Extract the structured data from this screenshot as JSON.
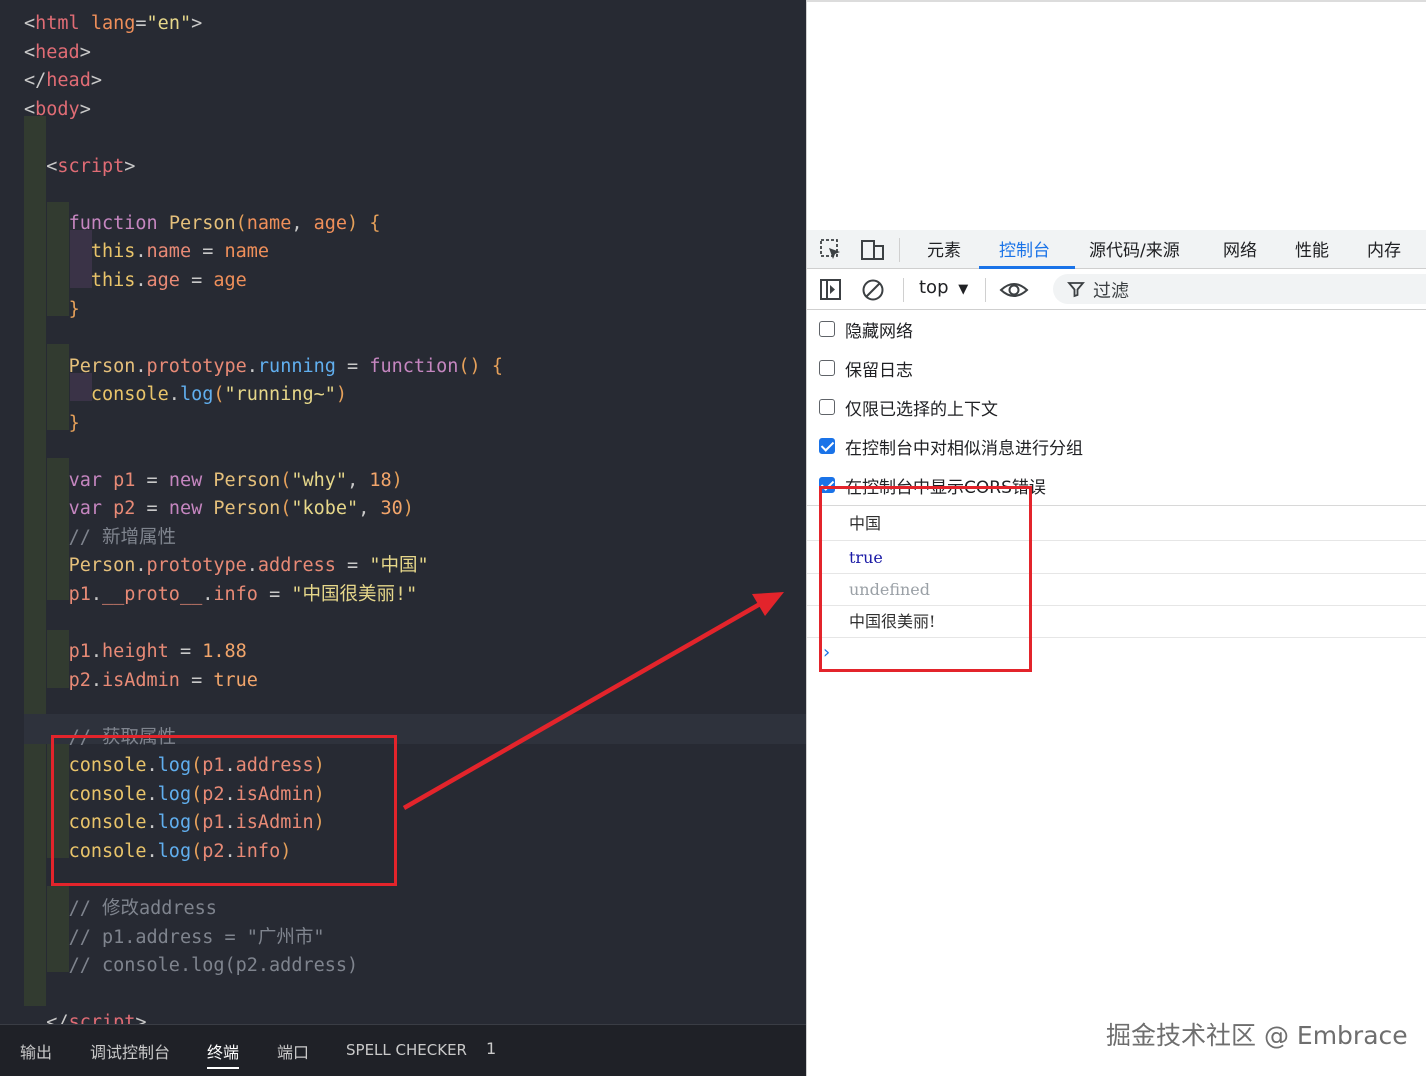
{
  "editor": {
    "lines": [
      [
        [
          "tag_lt",
          "<"
        ],
        [
          "tag",
          "html"
        ],
        [
          "plain",
          " "
        ],
        [
          "prm",
          "lang"
        ],
        [
          "op",
          "="
        ],
        [
          "str",
          "\"en\""
        ],
        [
          "tag_lt",
          ">"
        ]
      ],
      [
        [
          "tag_lt",
          "<"
        ],
        [
          "tag",
          "head"
        ],
        [
          "tag_lt",
          ">"
        ]
      ],
      [
        [
          "tag_lt",
          "</"
        ],
        [
          "tag",
          "head"
        ],
        [
          "tag_lt",
          ">"
        ]
      ],
      [
        [
          "tag_lt",
          "<"
        ],
        [
          "tag",
          "body"
        ],
        [
          "tag_lt",
          ">"
        ]
      ],
      [],
      [
        [
          "plain",
          "  "
        ],
        [
          "tag_lt",
          "<"
        ],
        [
          "tag",
          "script"
        ],
        [
          "tag_lt",
          ">"
        ]
      ],
      [],
      [
        [
          "plain",
          "    "
        ],
        [
          "kw",
          "function"
        ],
        [
          "plain",
          " "
        ],
        [
          "fn",
          "Person"
        ],
        [
          "brk",
          "("
        ],
        [
          "prm",
          "name"
        ],
        [
          "op",
          ", "
        ],
        [
          "prm",
          "age"
        ],
        [
          "brk",
          ")"
        ],
        [
          "plain",
          " "
        ],
        [
          "brk",
          "{"
        ]
      ],
      [
        [
          "plain",
          "      "
        ],
        [
          "obj",
          "this"
        ],
        [
          "op",
          "."
        ],
        [
          "prop",
          "name"
        ],
        [
          "op",
          " = "
        ],
        [
          "prm",
          "name"
        ]
      ],
      [
        [
          "plain",
          "      "
        ],
        [
          "obj",
          "this"
        ],
        [
          "op",
          "."
        ],
        [
          "prop",
          "age"
        ],
        [
          "op",
          " = "
        ],
        [
          "prm",
          "age"
        ]
      ],
      [
        [
          "plain",
          "    "
        ],
        [
          "brk",
          "}"
        ]
      ],
      [],
      [
        [
          "plain",
          "    "
        ],
        [
          "cls",
          "Person"
        ],
        [
          "op",
          "."
        ],
        [
          "prop",
          "prototype"
        ],
        [
          "op",
          "."
        ],
        [
          "meth",
          "running"
        ],
        [
          "op",
          " = "
        ],
        [
          "kw",
          "function"
        ],
        [
          "brk",
          "()"
        ],
        [
          "plain",
          " "
        ],
        [
          "brk",
          "{"
        ]
      ],
      [
        [
          "plain",
          "      "
        ],
        [
          "obj",
          "console"
        ],
        [
          "op",
          "."
        ],
        [
          "meth",
          "log"
        ],
        [
          "brk",
          "("
        ],
        [
          "str",
          "\"running~\""
        ],
        [
          "brk",
          ")"
        ]
      ],
      [
        [
          "plain",
          "    "
        ],
        [
          "brk",
          "}"
        ]
      ],
      [],
      [
        [
          "plain",
          "    "
        ],
        [
          "kw",
          "var"
        ],
        [
          "plain",
          " "
        ],
        [
          "prop",
          "p1"
        ],
        [
          "op",
          " = "
        ],
        [
          "kw",
          "new"
        ],
        [
          "plain",
          " "
        ],
        [
          "fn",
          "Person"
        ],
        [
          "brk",
          "("
        ],
        [
          "str",
          "\"why\""
        ],
        [
          "op",
          ", "
        ],
        [
          "num",
          "18"
        ],
        [
          "brk",
          ")"
        ]
      ],
      [
        [
          "plain",
          "    "
        ],
        [
          "kw",
          "var"
        ],
        [
          "plain",
          " "
        ],
        [
          "prop",
          "p2"
        ],
        [
          "op",
          " = "
        ],
        [
          "kw",
          "new"
        ],
        [
          "plain",
          " "
        ],
        [
          "fn",
          "Person"
        ],
        [
          "brk",
          "("
        ],
        [
          "str",
          "\"kobe\""
        ],
        [
          "op",
          ", "
        ],
        [
          "num",
          "30"
        ],
        [
          "brk",
          ")"
        ]
      ],
      [
        [
          "plain",
          "    "
        ],
        [
          "com",
          "// 新增属性"
        ]
      ],
      [
        [
          "plain",
          "    "
        ],
        [
          "cls",
          "Person"
        ],
        [
          "op",
          "."
        ],
        [
          "prop",
          "prototype"
        ],
        [
          "op",
          "."
        ],
        [
          "prop",
          "address"
        ],
        [
          "op",
          " = "
        ],
        [
          "str",
          "\"中国\""
        ]
      ],
      [
        [
          "plain",
          "    "
        ],
        [
          "prop",
          "p1"
        ],
        [
          "op",
          "."
        ],
        [
          "prop",
          "__proto__"
        ],
        [
          "op",
          "."
        ],
        [
          "prop",
          "info"
        ],
        [
          "op",
          " = "
        ],
        [
          "str",
          "\"中国很美丽!\""
        ]
      ],
      [],
      [
        [
          "plain",
          "    "
        ],
        [
          "prop",
          "p1"
        ],
        [
          "op",
          "."
        ],
        [
          "prop",
          "height"
        ],
        [
          "op",
          " = "
        ],
        [
          "num",
          "1.88"
        ]
      ],
      [
        [
          "plain",
          "    "
        ],
        [
          "prop",
          "p2"
        ],
        [
          "op",
          "."
        ],
        [
          "prop",
          "isAdmin"
        ],
        [
          "op",
          " = "
        ],
        [
          "num",
          "true"
        ]
      ],
      [],
      [
        [
          "plain",
          "    "
        ],
        [
          "com",
          "// 获取属性"
        ]
      ],
      [
        [
          "plain",
          "    "
        ],
        [
          "obj",
          "console"
        ],
        [
          "op",
          "."
        ],
        [
          "meth",
          "log"
        ],
        [
          "brk",
          "("
        ],
        [
          "prop",
          "p1"
        ],
        [
          "op",
          "."
        ],
        [
          "prop",
          "address"
        ],
        [
          "brk",
          ")"
        ]
      ],
      [
        [
          "plain",
          "    "
        ],
        [
          "obj",
          "console"
        ],
        [
          "op",
          "."
        ],
        [
          "meth",
          "log"
        ],
        [
          "brk",
          "("
        ],
        [
          "prop",
          "p2"
        ],
        [
          "op",
          "."
        ],
        [
          "prop",
          "isAdmin"
        ],
        [
          "brk",
          ")"
        ]
      ],
      [
        [
          "plain",
          "    "
        ],
        [
          "obj",
          "console"
        ],
        [
          "op",
          "."
        ],
        [
          "meth",
          "log"
        ],
        [
          "brk",
          "("
        ],
        [
          "prop",
          "p1"
        ],
        [
          "op",
          "."
        ],
        [
          "prop",
          "isAdmin"
        ],
        [
          "brk",
          ")"
        ]
      ],
      [
        [
          "plain",
          "    "
        ],
        [
          "obj",
          "console"
        ],
        [
          "op",
          "."
        ],
        [
          "meth",
          "log"
        ],
        [
          "brk",
          "("
        ],
        [
          "prop",
          "p2"
        ],
        [
          "op",
          "."
        ],
        [
          "prop",
          "info"
        ],
        [
          "brk",
          ")"
        ]
      ],
      [],
      [
        [
          "plain",
          "    "
        ],
        [
          "com",
          "// 修改address"
        ]
      ],
      [
        [
          "plain",
          "    "
        ],
        [
          "com",
          "// p1.address = \"广州市\""
        ]
      ],
      [
        [
          "plain",
          "    "
        ],
        [
          "com",
          "// console.log(p2.address)"
        ]
      ],
      [],
      [
        [
          "plain",
          "  "
        ],
        [
          "tag_lt",
          "</"
        ],
        [
          "tag",
          "script"
        ],
        [
          "tag_lt",
          ">"
        ]
      ]
    ],
    "bottom_tabs": [
      "输出",
      "调试控制台",
      "终端",
      "端口",
      "SPELL CHECKER",
      "1"
    ]
  },
  "devtools": {
    "tabs": [
      "元素",
      "控制台",
      "源代码/来源",
      "网络",
      "性能",
      "内存"
    ],
    "active_tab": "控制台",
    "context": "top",
    "filter_label": "过滤",
    "options": [
      {
        "label": "隐藏网络",
        "checked": false
      },
      {
        "label": "保留日志",
        "checked": false
      },
      {
        "label": "仅限已选择的上下文",
        "checked": false
      },
      {
        "label": "在控制台中对相似消息进行分组",
        "checked": true
      },
      {
        "label": "在控制台中显示CORS错误",
        "checked": true
      }
    ],
    "messages": [
      "中国",
      "true",
      "undefined",
      "中国很美丽!"
    ],
    "prompt": "›"
  },
  "watermark": "掘金技术社区 @ Embrace",
  "colors": {
    "annotation": "#e3242b",
    "accent": "#1a73e8",
    "editor_bg": "#272a33"
  }
}
